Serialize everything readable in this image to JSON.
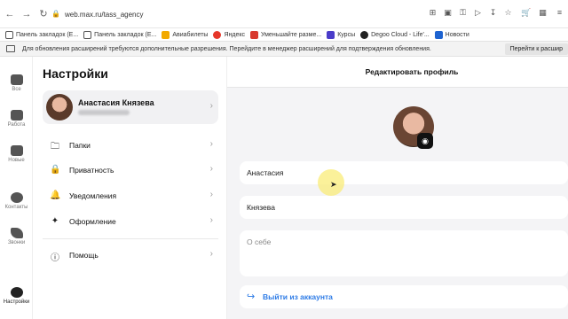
{
  "browser": {
    "url": "web.max.ru/tass_agency",
    "bookmarks": [
      {
        "label": "Панель закладок (E...",
        "color": "#555555"
      },
      {
        "label": "Панель закладок (E...",
        "color": "#555555"
      },
      {
        "label": "Авиабилеты",
        "color": "#f2a900"
      },
      {
        "label": "Яндекс",
        "color": "#e6372a"
      },
      {
        "label": "Уменьшайте разме...",
        "color": "#d83a2f"
      },
      {
        "label": "Курсы",
        "color": "#4a3cc9"
      },
      {
        "label": "Degoo Cloud - Life'...",
        "color": "#222222"
      },
      {
        "label": "Новости",
        "color": "#1e63d0"
      }
    ],
    "notice_text": "Для обновления расширений требуются дополнительные разрешения. Перейдите в менеджер расширений для подтверждения обновления.",
    "notice_button": "Перейти к расшир"
  },
  "rail": {
    "items": [
      {
        "label": "Все"
      },
      {
        "label": "Работа"
      },
      {
        "label": "Новые"
      },
      {
        "label": "Контакты"
      },
      {
        "label": "Звонки"
      },
      {
        "label": "Настройки"
      }
    ]
  },
  "settings": {
    "title": "Настройки",
    "profile_name": "Анастасия Князева",
    "menu": [
      {
        "label": "Папки",
        "icon": "folder-icon"
      },
      {
        "label": "Приватность",
        "icon": "lock-icon"
      },
      {
        "label": "Уведомления",
        "icon": "bell-icon"
      },
      {
        "label": "Оформление",
        "icon": "magic-wand-icon"
      },
      {
        "label": "Помощь",
        "icon": "help-icon"
      }
    ]
  },
  "edit_profile": {
    "title": "Редактировать профиль",
    "first_name": "Анастасия",
    "last_name": "Князева",
    "about_placeholder": "О себе",
    "logout_label": "Выйти из аккаунта",
    "accent_color": "#2d7be6"
  }
}
